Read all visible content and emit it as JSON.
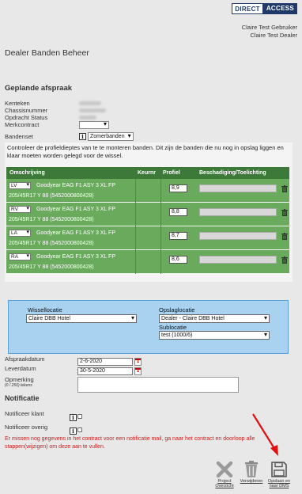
{
  "logo": {
    "part1": "DIRECT",
    "part2": "ACCESS"
  },
  "user": {
    "line1": "Claire Test Gebruiker",
    "line2": "Claire Test Dealer"
  },
  "page_title": "Dealer Banden Beheer",
  "section": {
    "title": "Geplande afspraak",
    "fields": [
      "Kenteken",
      "Chassisnummer",
      "Opdracht Status",
      "Merkcontract"
    ],
    "bandenset_label": "Bandenset",
    "bandenset_value": "Zomerbanden",
    "merkcontract_value": ""
  },
  "intro": "Controleer de profieldieptes van te te monteren banden. Dit zijn de banden die nu nog in opslag liggen en klaar moeten worden gelegd voor de wissel.",
  "table": {
    "headers": {
      "description": "Omschrijving",
      "kernr": "Keurnr",
      "profile": "Profiel",
      "damage": "Beschadiging/Toelichting"
    },
    "rows": [
      {
        "pos": "LV",
        "desc": "Goodyear EAG F1 ASY 3 XL FP",
        "desc2": "205/45R17 Y 88 (5452000800428)",
        "profile": "8,9"
      },
      {
        "pos": "RV",
        "desc": "Goodyear EAG F1 ASY 3 XL FP",
        "desc2": "205/45R17 Y 88 (5452000800428)",
        "profile": "8,8"
      },
      {
        "pos": "LA",
        "desc": "Goodyear EAG F1 ASY 3 XL FP",
        "desc2": "205/45R17 Y 88 (5452000800428)",
        "profile": "8,7"
      },
      {
        "pos": "RA",
        "desc": "Goodyear EAG F1 ASY 3 XL FP",
        "desc2": "205/45R17 Y 88 (5452000800428)",
        "profile": "8,6"
      }
    ]
  },
  "location": {
    "wissel_label": "Wissellocatie",
    "wissel_value": "Claire DBB Hotel",
    "opslag_label": "Opslaglocatie",
    "opslag_value": "Dealer - Claire DBB Hotel",
    "sub_label": "Sublocatie",
    "sub_value": "test (1000/6)"
  },
  "dates": {
    "afspraak_label": "Afspraakdatum",
    "afspraak_value": "2-6-2020",
    "lever_label": "Leverdatum",
    "lever_value": "30-5-2020",
    "opmerking_label": "Opmerking",
    "opmerking_hint": "(0 / 250) tekens",
    "cal_glyph": "1"
  },
  "notification": {
    "title": "Notificatie",
    "klant_label": "Notificeer klant",
    "overig_label": "Notificeer overig"
  },
  "warning": "Er missen nog gegevens in het contract voor een notificatie mail, ga naar het contract en doorloop alle stappen(wijzigen) om deze aan te vullen.",
  "actions": {
    "project": [
      "Project",
      "Overzicht"
    ],
    "delete": [
      "Verwijderen"
    ],
    "save": [
      "Opslaan en",
      "naar DMS"
    ]
  },
  "colors": {
    "table_header": "#3d7a3a",
    "table_row": "#6aaa5d",
    "location_bg": "#a8d2f0",
    "warning": "#d21a1a",
    "arrow": "#e01010"
  }
}
